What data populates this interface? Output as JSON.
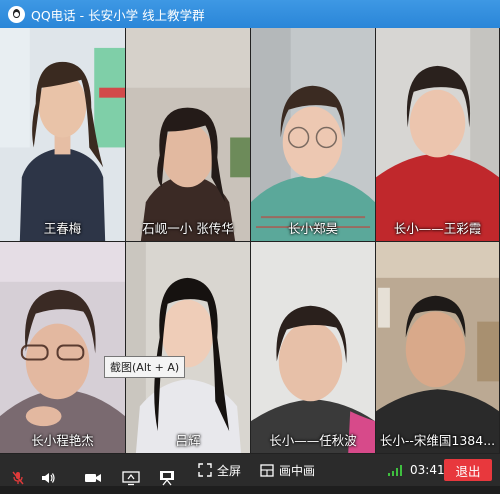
{
  "window": {
    "title": "QQ电话 - 长安小学 线上教学群"
  },
  "participants": [
    {
      "name": "王春梅",
      "bg": "#d8dde2",
      "shirt": "#2d3547"
    },
    {
      "name": "石岘一小 张传华",
      "bg": "#c9c1b7",
      "shirt": "#3b2a25"
    },
    {
      "name": "长小郑昊",
      "bg": "#c2c6c8",
      "shirt": "#5ba89a"
    },
    {
      "name": "长小——王彩霞",
      "bg": "#d2d2d0",
      "shirt": "#c0282c"
    },
    {
      "name": "长小程艳杰",
      "bg": "#cfc9cf",
      "shirt": "#7a6a70"
    },
    {
      "name": "吕辉",
      "bg": "#d9d6d0",
      "shirt": "#e8e8ec"
    },
    {
      "name": "长小——任秋波",
      "bg": "#e3e3e1",
      "shirt": "#3a3a3a"
    },
    {
      "name": "长小--宋维国1384...",
      "bg": "#b9aa96",
      "shirt": "#2a2a2a"
    }
  ],
  "tooltip": {
    "text": "截图(Alt + A)"
  },
  "toolbar": {
    "fullscreen_label": "全屏",
    "pip_label": "画中画",
    "timer": "03:41",
    "exit_label": "退出"
  },
  "colors": {
    "accent": "#2a86d8",
    "exit": "#e8383d",
    "signal": "#3fbf3f"
  }
}
